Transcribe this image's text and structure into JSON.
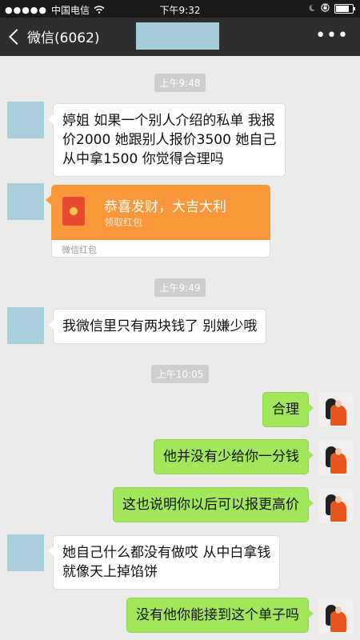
{
  "status_bar": {
    "carrier": "中国电信",
    "time": "下午9:32",
    "signal_icon": "signal-dots-icon",
    "wifi_icon": "wifi-icon",
    "lock_icon": "rotation-lock-icon",
    "moon_icon": "moon-icon",
    "battery_icon": "battery-icon",
    "battery_level": 0.85
  },
  "nav": {
    "back_label": "微信(6062)",
    "more_label": "•••"
  },
  "messages": [
    {
      "kind": "timestamp",
      "text": "上午9:48"
    },
    {
      "kind": "incoming",
      "text_lines": [
        "婷姐 如果一个别人介绍的私单 我报",
        "价2000 她跟别人报价3500 她自己",
        "从中拿1500 你觉得合理吗"
      ]
    },
    {
      "kind": "red_packet",
      "title": "恭喜发财，大吉大利",
      "subtitle": "领取红包",
      "footer": "微信红包"
    },
    {
      "kind": "timestamp",
      "text": "上午9:49"
    },
    {
      "kind": "incoming",
      "text": "我微信里只有两块钱了 别嫌少哦"
    },
    {
      "kind": "timestamp",
      "text": "上午10:05"
    },
    {
      "kind": "outgoing",
      "text": "合理"
    },
    {
      "kind": "outgoing",
      "text": "他并没有少给你一分钱"
    },
    {
      "kind": "outgoing",
      "text": "这也说明你以后可以报更高价"
    },
    {
      "kind": "incoming",
      "text_lines": [
        "她自己什么都没有做哎 从中白拿钱",
        "就像天上掉馅饼"
      ]
    },
    {
      "kind": "outgoing",
      "text": "没有他你能接到这个单子吗"
    }
  ],
  "colors": {
    "nav_bg": "#2e2e30",
    "chat_bg": "#ebebeb",
    "outgoing_bubble": "#a0e75a",
    "incoming_bubble": "#ffffff",
    "red_packet": "#f9973a"
  }
}
